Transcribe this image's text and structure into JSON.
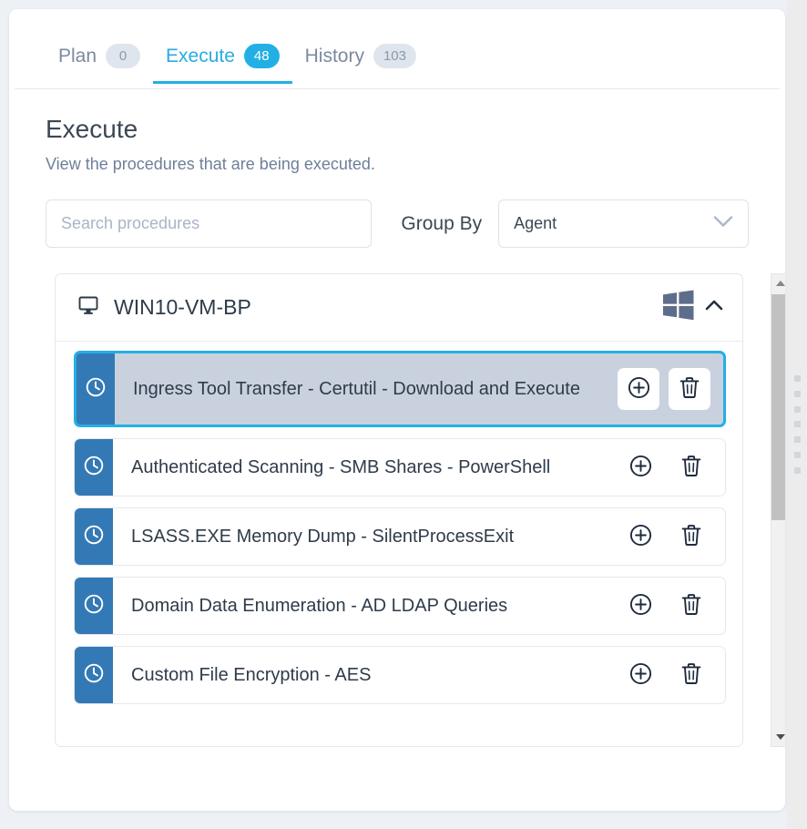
{
  "tabs": [
    {
      "label": "Plan",
      "badge": "0",
      "active": false
    },
    {
      "label": "Execute",
      "badge": "48",
      "active": true
    },
    {
      "label": "History",
      "badge": "103",
      "active": false
    }
  ],
  "header": {
    "title": "Execute",
    "subtitle": "View the procedures that are being executed."
  },
  "controls": {
    "search_placeholder": "Search procedures",
    "search_value": "",
    "group_by_label": "Group By",
    "group_by_value": "Agent",
    "group_by_options": [
      "Agent"
    ]
  },
  "group": {
    "name": "WIN10-VM-BP",
    "platform_icon": "windows-logo-icon",
    "host_icon": "monitor-icon",
    "collapse_icon": "chevron-up-icon",
    "expanded": true
  },
  "procedures": [
    {
      "title": "Ingress Tool Transfer - Certutil - Download and Execute",
      "selected": true,
      "status_icon": "clock-icon",
      "add_label": "add-icon",
      "delete_label": "trash-icon"
    },
    {
      "title": "Authenticated Scanning - SMB Shares - PowerShell",
      "selected": false,
      "status_icon": "clock-icon",
      "add_label": "add-icon",
      "delete_label": "trash-icon"
    },
    {
      "title": "LSASS.EXE Memory Dump - SilentProcessExit",
      "selected": false,
      "status_icon": "clock-icon",
      "add_label": "add-icon",
      "delete_label": "trash-icon"
    },
    {
      "title": "Domain Data Enumeration - AD LDAP Queries",
      "selected": false,
      "status_icon": "clock-icon",
      "add_label": "add-icon",
      "delete_label": "trash-icon"
    },
    {
      "title": "Custom File Encryption - AES",
      "selected": false,
      "status_icon": "clock-icon",
      "add_label": "add-icon",
      "delete_label": "trash-icon"
    }
  ],
  "colors": {
    "accent_cyan": "#22b0e4",
    "row_bar_blue": "#3379b5",
    "selected_fill": "#c9d1de",
    "text_dark": "#2f3b4a",
    "text_muted": "#6d7f99",
    "page_bg": "#edf1f5",
    "windows_logo": "#5d6e8c"
  }
}
